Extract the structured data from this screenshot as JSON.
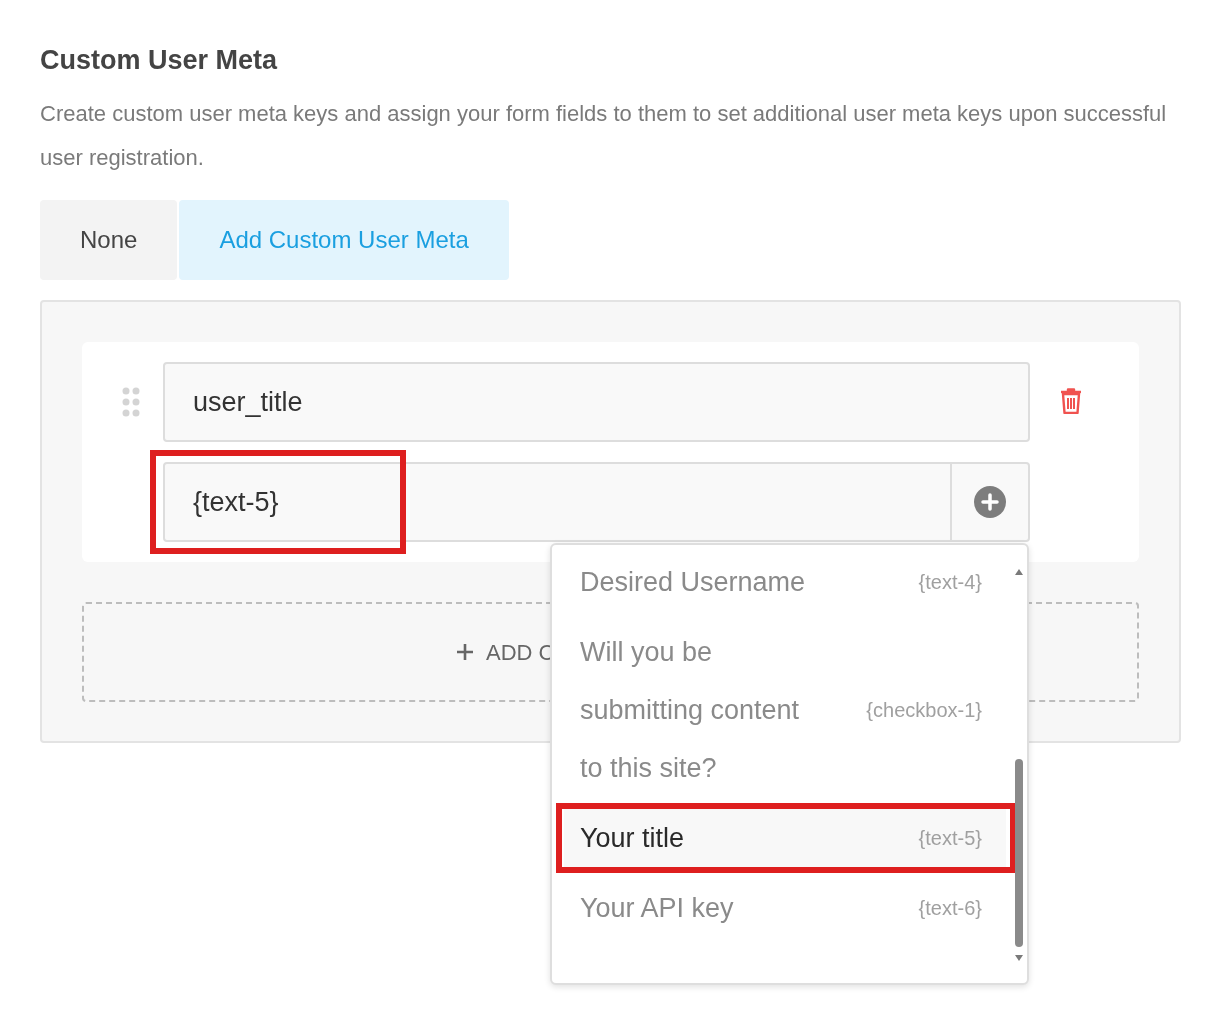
{
  "section": {
    "title": "Custom User Meta",
    "description": "Create custom user meta keys and assign your form fields to them to set additional user meta keys upon successful user registration."
  },
  "tabs": [
    {
      "label": "None",
      "selected": false
    },
    {
      "label": "Add Custom User Meta",
      "selected": true
    }
  ],
  "meta_row": {
    "key": {
      "value": "user_title"
    },
    "field": {
      "value": "{text-5}",
      "highlighted": true
    }
  },
  "add_button": {
    "label": "ADD C"
  },
  "dropdown": {
    "options": [
      {
        "label": "Desired Username",
        "tag": "{text-4}",
        "selected": false
      },
      {
        "label": "Will you be submitting content to this site?",
        "tag": "{checkbox-1}",
        "selected": false
      },
      {
        "label": "Your title",
        "tag": "{text-5}",
        "selected": true
      },
      {
        "label": "Your API key",
        "tag": "{text-6}",
        "selected": false
      }
    ]
  }
}
